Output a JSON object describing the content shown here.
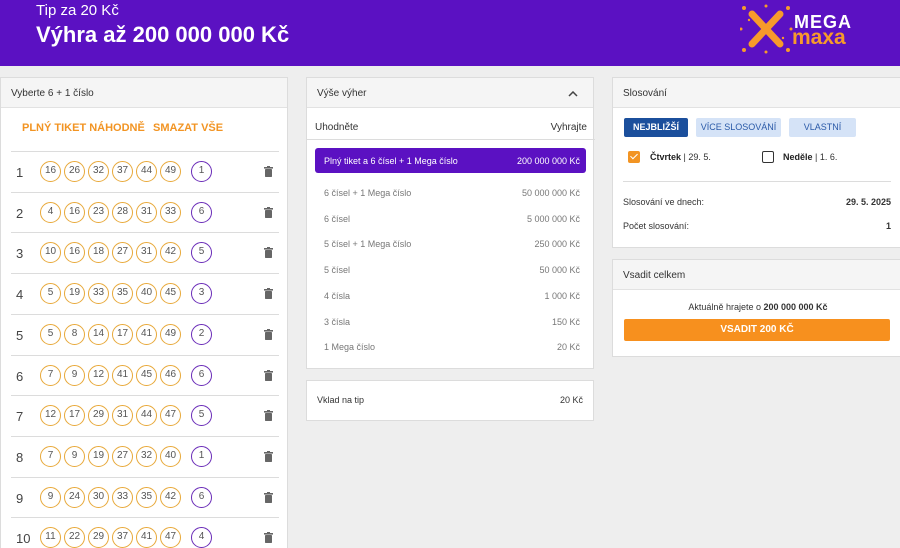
{
  "header": {
    "subtitle": "Tip za 20 Kč",
    "title": "Výhra až 200 000 000 Kč",
    "logo_top": "MEGA",
    "logo_bottom": "maxa"
  },
  "colors": {
    "brand_purple": "#5b11c2",
    "accent_orange": "#f29423",
    "ball_ring": "#e8a93a",
    "mega_ring": "#6a2cb8",
    "tab_active": "#1b4f9c"
  },
  "ticket": {
    "heading": "Vyberte 6 + 1 číslo",
    "random_label": "PLNÝ TIKET NÁHODNĚ",
    "clear_label": "SMAZAT VŠE",
    "rows": [
      {
        "n": "1",
        "numbers": [
          "16",
          "26",
          "32",
          "37",
          "44",
          "49"
        ],
        "mega": "1"
      },
      {
        "n": "2",
        "numbers": [
          "4",
          "16",
          "23",
          "28",
          "31",
          "33"
        ],
        "mega": "6"
      },
      {
        "n": "3",
        "numbers": [
          "10",
          "16",
          "18",
          "27",
          "31",
          "42"
        ],
        "mega": "5"
      },
      {
        "n": "4",
        "numbers": [
          "5",
          "19",
          "33",
          "35",
          "40",
          "45"
        ],
        "mega": "3"
      },
      {
        "n": "5",
        "numbers": [
          "5",
          "8",
          "14",
          "17",
          "41",
          "49"
        ],
        "mega": "2"
      },
      {
        "n": "6",
        "numbers": [
          "7",
          "9",
          "12",
          "41",
          "45",
          "46"
        ],
        "mega": "6"
      },
      {
        "n": "7",
        "numbers": [
          "12",
          "17",
          "29",
          "31",
          "44",
          "47"
        ],
        "mega": "5"
      },
      {
        "n": "8",
        "numbers": [
          "7",
          "9",
          "19",
          "27",
          "32",
          "40"
        ],
        "mega": "1"
      },
      {
        "n": "9",
        "numbers": [
          "9",
          "24",
          "30",
          "33",
          "35",
          "42"
        ],
        "mega": "6"
      },
      {
        "n": "10",
        "numbers": [
          "11",
          "22",
          "29",
          "37",
          "41",
          "47"
        ],
        "mega": "4"
      }
    ],
    "delete_icon": "trash-icon"
  },
  "prizes": {
    "heading": "Výše výher",
    "collapse_icon": "chevron-up-icon",
    "col_guess": "Uhodněte",
    "col_win": "Vyhrajte",
    "items": [
      {
        "label": "Plný tiket a 6 čísel + 1 Mega číslo",
        "amount": "200 000 000 Kč"
      },
      {
        "label": "6 čísel + 1 Mega číslo",
        "amount": "50 000 000 Kč"
      },
      {
        "label": "6 čísel",
        "amount": "5 000 000 Kč"
      },
      {
        "label": "5 čísel + 1 Mega číslo",
        "amount": "250 000 Kč"
      },
      {
        "label": "5 čísel",
        "amount": "50 000 Kč"
      },
      {
        "label": "4 čísla",
        "amount": "1 000 Kč"
      },
      {
        "label": "3 čísla",
        "amount": "150 Kč"
      },
      {
        "label": "1 Mega číslo",
        "amount": "20 Kč"
      }
    ],
    "stake_label": "Vklad na tip",
    "stake_value": "20 Kč"
  },
  "draws": {
    "heading": "Slosování",
    "tabs": [
      "NEJBLIŽŠÍ",
      "VÍCE SLOSOVÁNÍ",
      "VLASTNÍ"
    ],
    "days": [
      {
        "day": "Čtvrtek",
        "date": "| 29. 5.",
        "checked": true
      },
      {
        "day": "Neděle",
        "date": "| 1. 6.",
        "checked": false
      }
    ],
    "draw_days_label": "Slosování ve dnech:",
    "draw_days_value": "29. 5. 2025",
    "count_label": "Počet slosování:",
    "count_value": "1"
  },
  "bet": {
    "heading": "Vsadit celkem",
    "msg_prefix": "Aktuálně hrajete o",
    "msg_amount": "200 000 000 Kč",
    "button": "VSADIT 200 KČ"
  }
}
